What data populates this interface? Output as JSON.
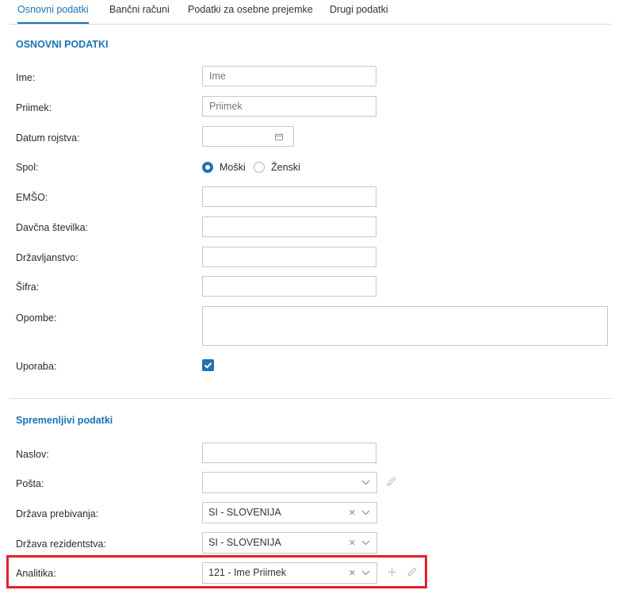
{
  "tabs": [
    "Osnovni podatki",
    "Bančni računi",
    "Podatki za osebne prejemke",
    "Drugi podatki"
  ],
  "section1": {
    "title": "OSNOVNI PODATKI",
    "ime": {
      "label": "Ime:",
      "placeholder": "Ime"
    },
    "priimek": {
      "label": "Priimek:",
      "placeholder": "Priimek"
    },
    "datum": {
      "label": "Datum rojstva:",
      "icon": "calendar-icon"
    },
    "spol": {
      "label": "Spol:",
      "options": [
        "Moški",
        "Ženski"
      ],
      "selected": "Moški"
    },
    "emso": {
      "label": "EMŠO:"
    },
    "davcna": {
      "label": "Davčna številka:"
    },
    "drzavljanstvo": {
      "label": "Državljanstvo:"
    },
    "sifra": {
      "label": "Šifra:"
    },
    "opombe": {
      "label": "Opombe:"
    },
    "uporaba": {
      "label": "Uporaba:",
      "checked": true
    }
  },
  "section2": {
    "title": "Spremenljivi podatki",
    "naslov": {
      "label": "Naslov:"
    },
    "posta": {
      "label": "Pošta:",
      "value": ""
    },
    "drzava_prebivanja": {
      "label": "Država prebivanja:",
      "value": "SI - SLOVENIJA"
    },
    "drzava_rezidentstva": {
      "label": "Država rezidentstva:",
      "value": "SI - SLOVENIJA"
    },
    "analitika": {
      "label": "Analitika:",
      "value": "121 - Ime Priimek"
    }
  },
  "colors": {
    "accent": "#1a73b5",
    "highlight": "#e3202a"
  }
}
